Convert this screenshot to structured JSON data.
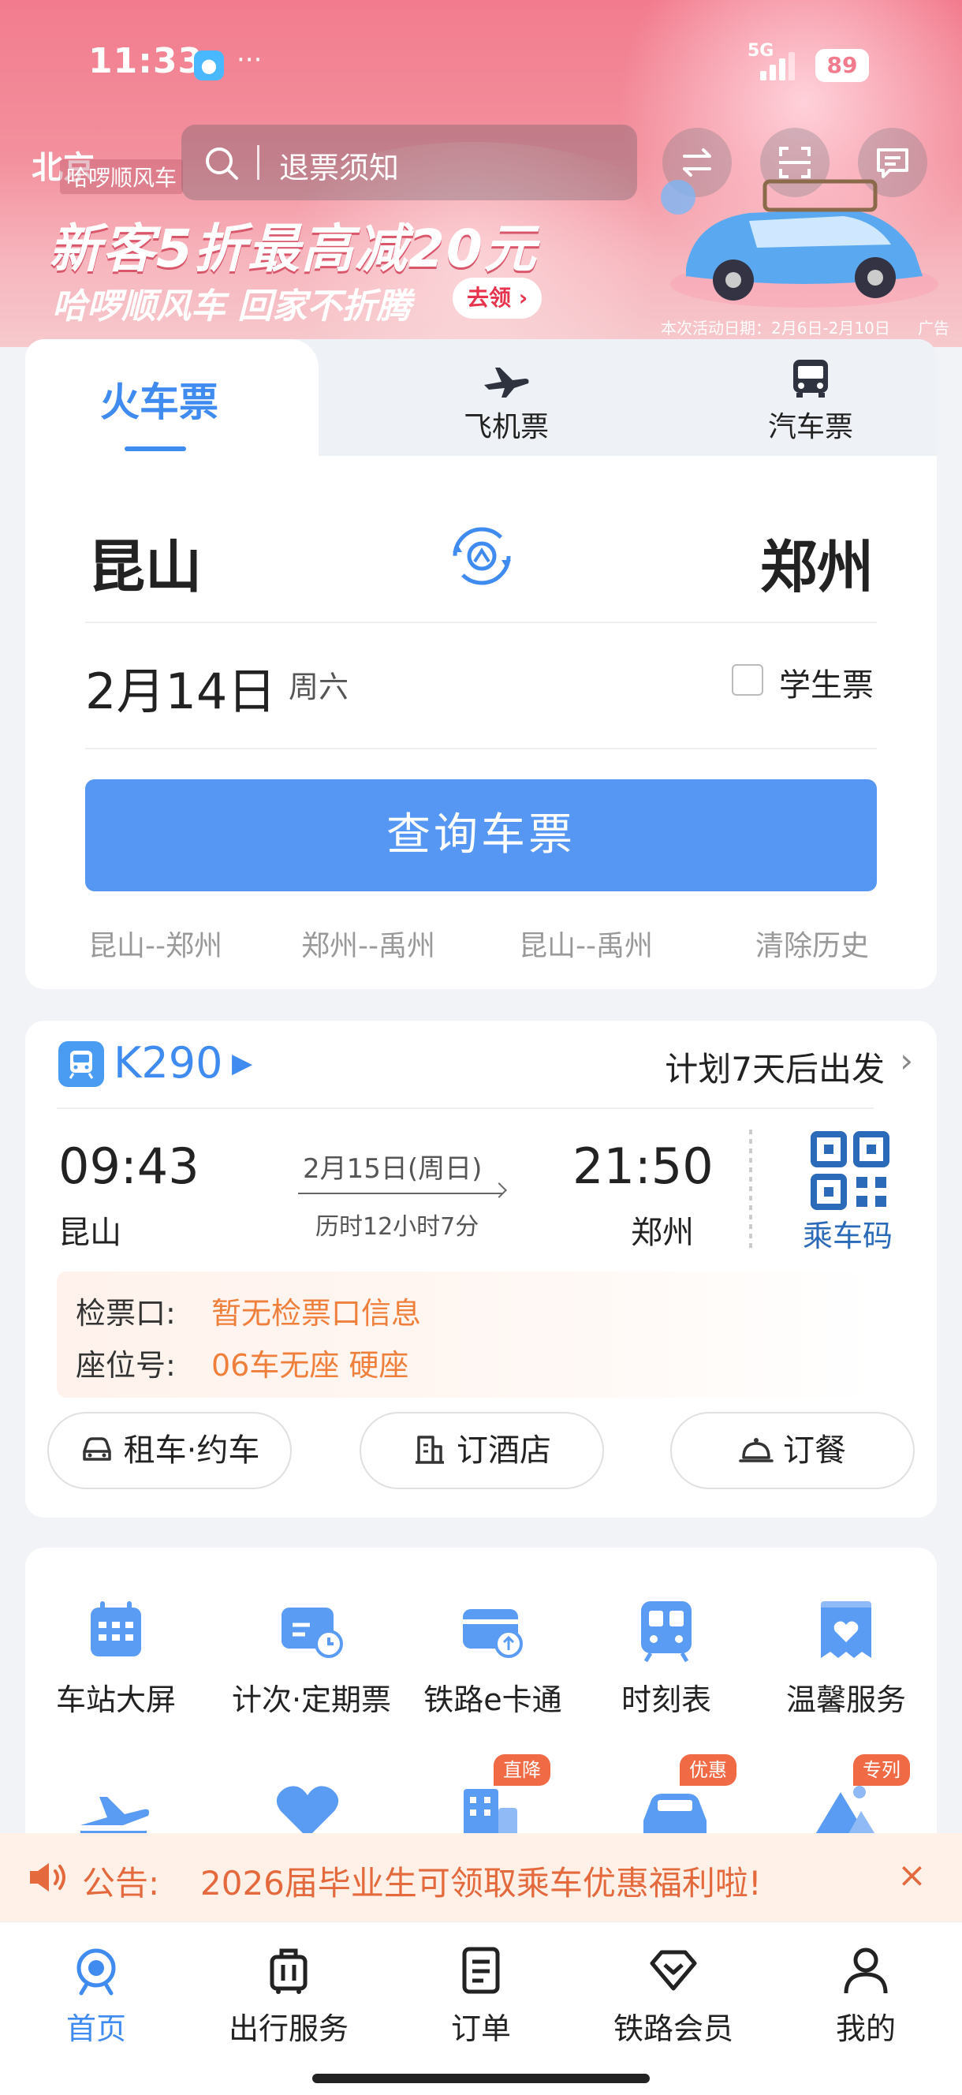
{
  "status_bar": {
    "time": "11:33",
    "network": "5G",
    "battery": "89"
  },
  "header": {
    "city": "北京",
    "search_placeholder": "退票须知"
  },
  "promo": {
    "brand": "哈啰顺风车",
    "title": "新客5折最高减20元",
    "subtitle": "哈啰顺风车 回家不折腾",
    "button": "去领",
    "date_note": "本次活动日期：2月6日-2月10日",
    "ad_tag": "广告"
  },
  "ticket": {
    "tabs": [
      {
        "label": "火车票",
        "active": true
      },
      {
        "label": "飞机票",
        "icon": "airplane-icon"
      },
      {
        "label": "汽车票",
        "icon": "bus-icon"
      }
    ],
    "from": "昆山",
    "to": "郑州",
    "date": "2月14日",
    "weekday": "周六",
    "student_label": "学生票",
    "student_checked": false,
    "query_button": "查询车票",
    "history": [
      "昆山--郑州",
      "郑州--禹州",
      "昆山--禹州",
      "清除历史"
    ]
  },
  "trip": {
    "train_no": "K290",
    "plan": "计划7天后出发",
    "depart_time": "09:43",
    "depart_station": "昆山",
    "arrive_time": "21:50",
    "arrive_station": "郑州",
    "arrive_date": "2月15日(周日)",
    "duration": "历时12小时7分",
    "qr_label": "乘车码",
    "check_in_label": "检票口:",
    "check_in_value": "暂无检票口信息",
    "seat_label": "座位号:",
    "seat_value": "06车无座 硬座",
    "actions": [
      {
        "label": "租车·约车",
        "icon": "car-icon"
      },
      {
        "label": "订酒店",
        "icon": "hotel-icon"
      },
      {
        "label": "订餐",
        "icon": "food-cloche-icon"
      }
    ]
  },
  "services": {
    "row1": [
      {
        "label": "车站大屏",
        "icon": "calendar-grid-icon"
      },
      {
        "label": "计次·定期票",
        "icon": "timed-ticket-icon"
      },
      {
        "label": "铁路e卡通",
        "icon": "rail-card-icon"
      },
      {
        "label": "时刻表",
        "icon": "timetable-train-icon"
      },
      {
        "label": "温馨服务",
        "icon": "heart-service-icon"
      }
    ],
    "row2_tags": [
      "直降",
      "优惠",
      "专列"
    ]
  },
  "notice": {
    "label": "公告:",
    "text": "2026届毕业生可领取乘车优惠福利啦!",
    "close": "×"
  },
  "bottom_nav": [
    {
      "label": "首页",
      "active": true
    },
    {
      "label": "出行服务"
    },
    {
      "label": "订单"
    },
    {
      "label": "铁路会员"
    },
    {
      "label": "我的"
    }
  ],
  "colors": {
    "primary": "#3f8bf0",
    "button": "#5597f2",
    "notice": "#e4693c",
    "banner": "#f27c8e"
  }
}
